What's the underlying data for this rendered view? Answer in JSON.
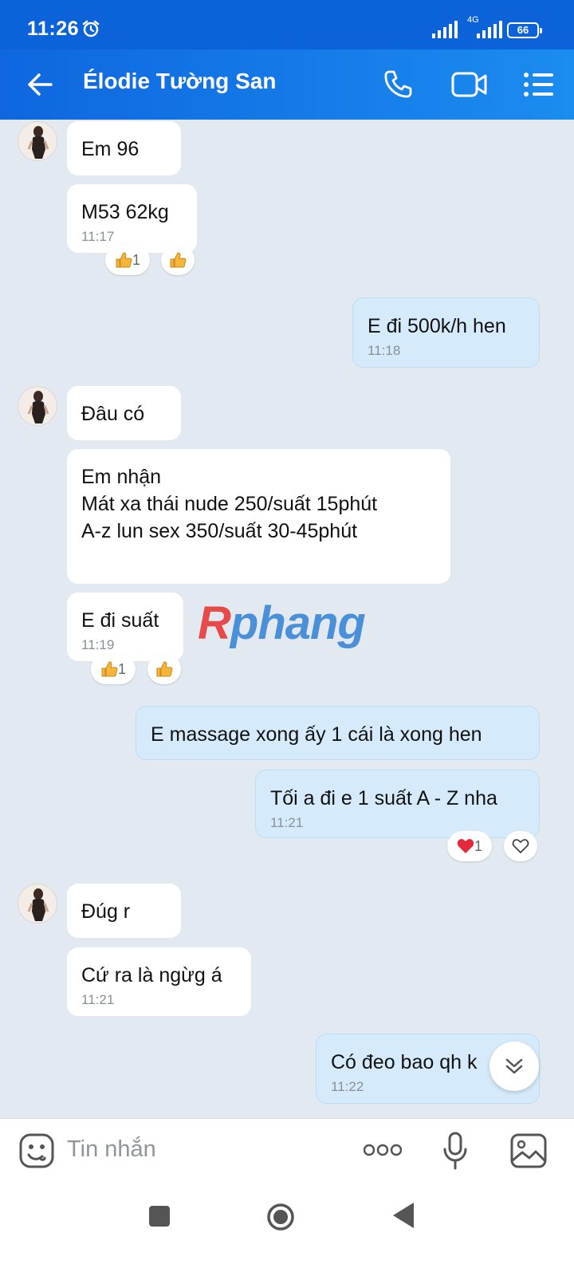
{
  "status_bar": {
    "time": "11:26",
    "network": "4G",
    "battery": "66"
  },
  "header": {
    "title": "Élodie Tường San"
  },
  "messages": [
    {
      "text": "Em 96"
    },
    {
      "text": "M53 62kg",
      "time": "11:17",
      "reaction_count": "1"
    },
    {
      "text": "E đi 500k/h hen",
      "time": "11:18"
    },
    {
      "text": "Đâu có"
    },
    {
      "lines": [
        "Em nhận",
        "Mát xa thái nude 250/suất 15phút",
        "A-z lun sex 350/suất 30-45phút"
      ]
    },
    {
      "text": "E đi suất",
      "time": "11:19",
      "reaction_count": "1"
    },
    {
      "text": "E massage xong ấy 1 cái là xong hen"
    },
    {
      "text": "Tối a đi e 1 suất A - Z nha",
      "time": "11:21",
      "reaction_count": "1"
    },
    {
      "text": "Đúg r"
    },
    {
      "text": "Cứ ra là ngừg á",
      "time": "11:21"
    },
    {
      "text": "Có đeo bao qh k",
      "time": "11:22"
    }
  ],
  "watermark": {
    "first": "R",
    "rest": "phang"
  },
  "input": {
    "placeholder": "Tin nhắn"
  },
  "icons": {
    "back": "arrow-left-icon",
    "call": "phone-icon",
    "video": "video-camera-icon",
    "menu": "list-menu-icon",
    "reaction_sent": "thumbs-up-icon",
    "reaction_heart": "heart-icon",
    "emoji": "emoji-icon",
    "more": "more-dots-icon",
    "mic": "microphone-icon",
    "image": "image-icon",
    "scroll": "chevron-double-down-icon"
  },
  "colors": {
    "header": "#0e67df",
    "incoming_bubble": "#ffffff",
    "outgoing_bubble": "#d5ebfc",
    "background": "#e2e9f1"
  }
}
